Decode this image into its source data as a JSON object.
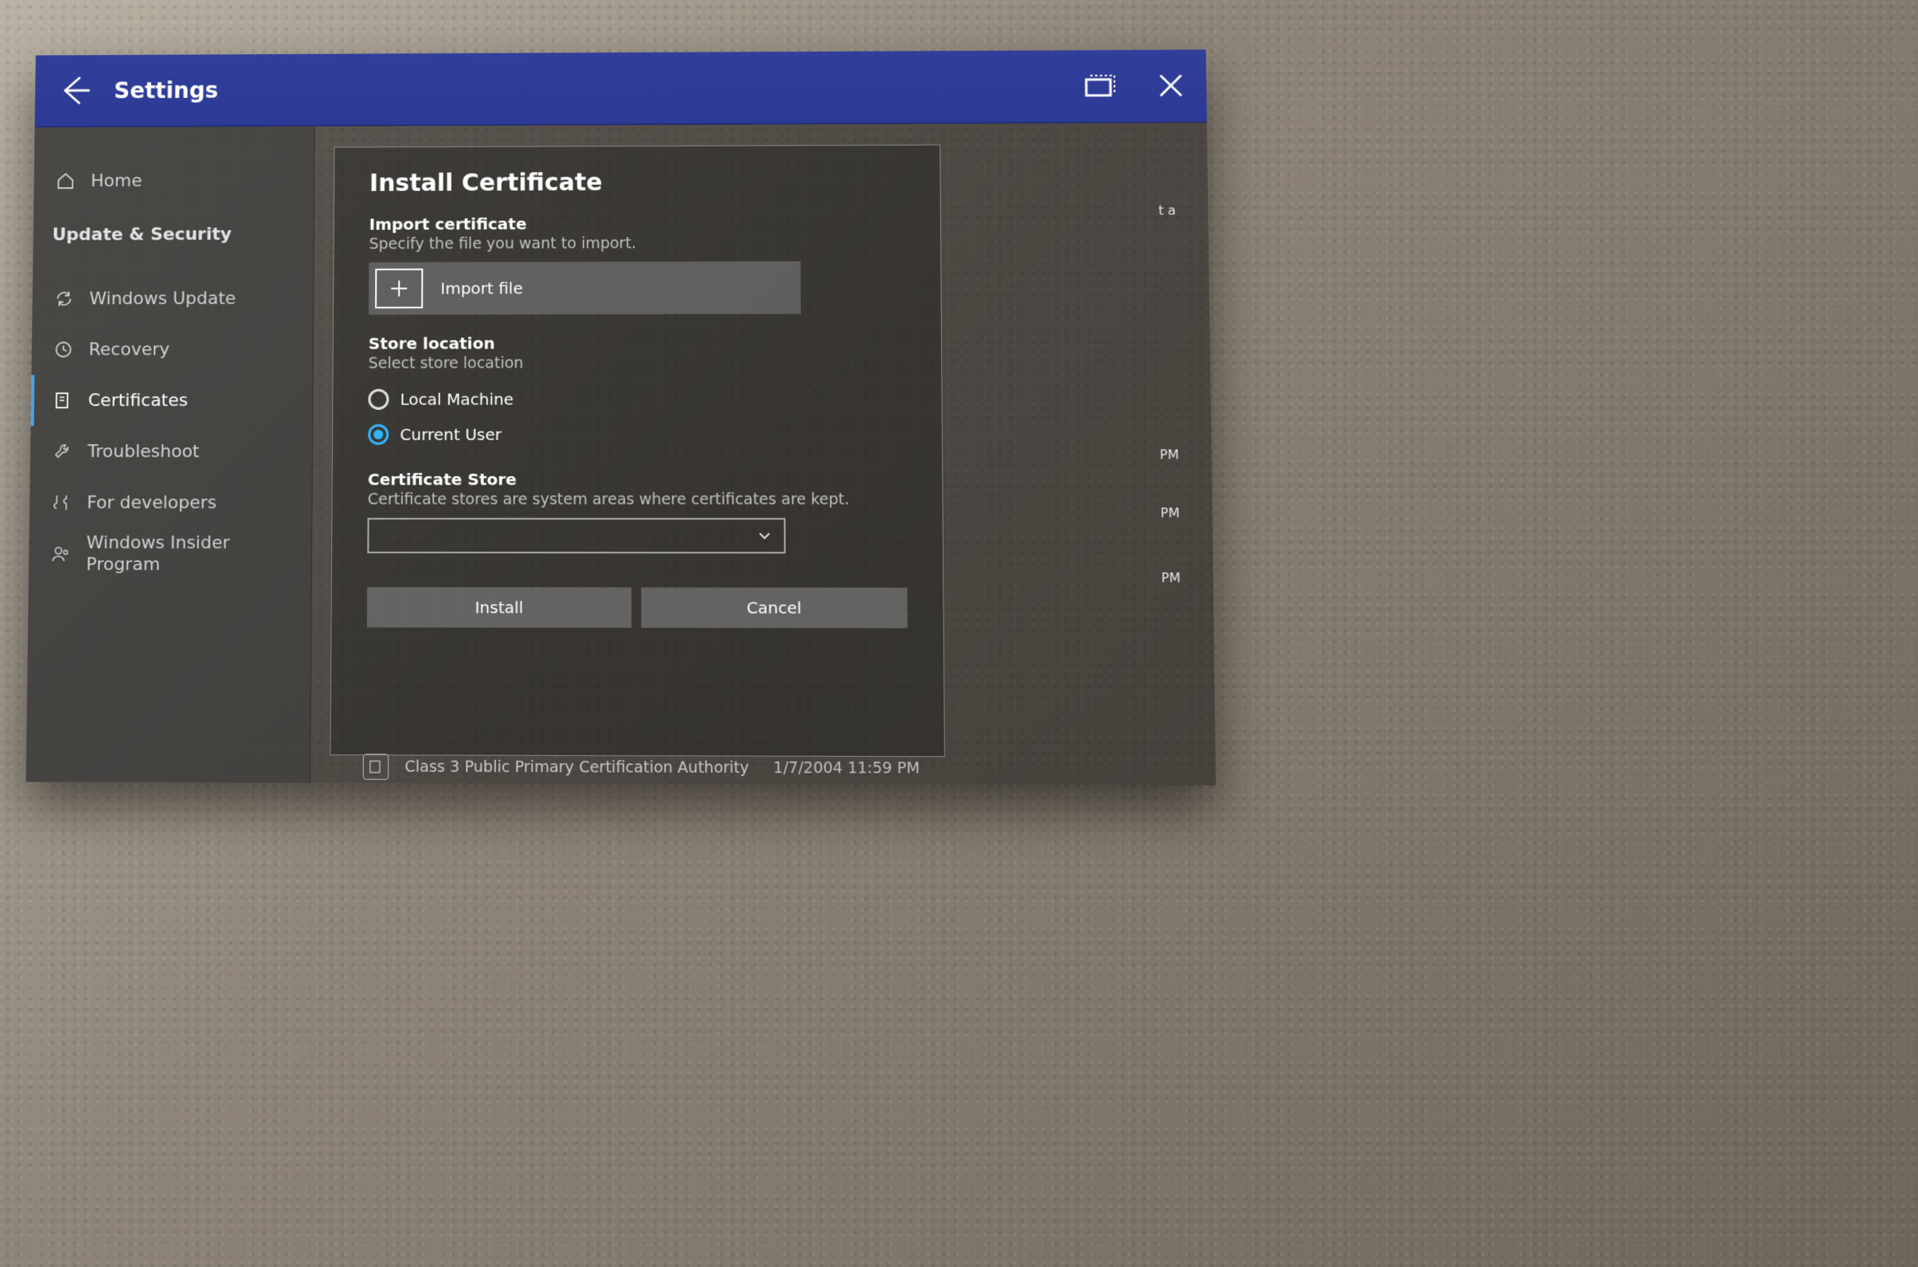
{
  "header": {
    "title": "Settings"
  },
  "sidebar": {
    "home": "Home",
    "section": "Update & Security",
    "items": [
      {
        "label": "Windows Update"
      },
      {
        "label": "Recovery"
      },
      {
        "label": "Certificates"
      },
      {
        "label": "Troubleshoot"
      },
      {
        "label": "For developers"
      },
      {
        "label": "Windows Insider Program"
      }
    ]
  },
  "dialog": {
    "title": "Install Certificate",
    "import": {
      "title": "Import certificate",
      "sub": "Specify the file you want to import.",
      "button": "Import file"
    },
    "store_location": {
      "title": "Store location",
      "sub": "Select store location",
      "option_local": "Local Machine",
      "option_user": "Current User"
    },
    "cert_store": {
      "title": "Certificate Store",
      "sub": "Certificate stores are system areas where certificates are kept.",
      "value": ""
    },
    "install": "Install",
    "cancel": "Cancel"
  },
  "background": {
    "frag1": "t a",
    "pm1": "PM",
    "pm2": "PM",
    "pm3": "PM",
    "cert_name": "Class 3 Public Primary Certification Authority",
    "cert_date": "1/7/2004 11:59 PM"
  }
}
